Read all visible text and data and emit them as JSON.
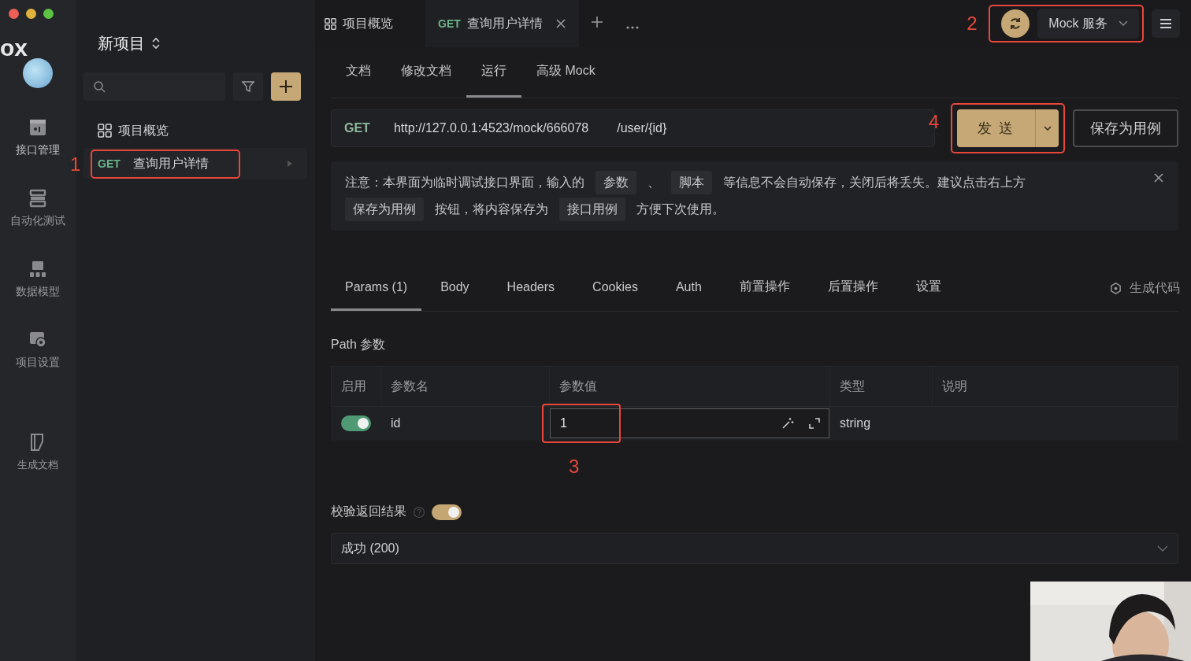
{
  "window": {
    "app_name_fragment": "ox"
  },
  "project": {
    "name": "新项目"
  },
  "rail": {
    "items": [
      {
        "kind": "api",
        "label": "接口管理",
        "selected": true
      },
      {
        "kind": "automation",
        "label": "自动化测试",
        "selected": false
      },
      {
        "kind": "schema",
        "label": "数据模型",
        "selected": false
      },
      {
        "kind": "settings",
        "label": "项目设置",
        "selected": false
      },
      {
        "kind": "docs",
        "label": "生成文档",
        "selected": false
      }
    ]
  },
  "tree": {
    "items": [
      {
        "kind": "overview",
        "label": "项目概览",
        "selected": false
      },
      {
        "kind": "endpoint",
        "method": "GET",
        "label": "查询用户详情",
        "selected": true,
        "annotation": "1"
      }
    ]
  },
  "tabs": [
    {
      "kind": "overview",
      "label": "项目概览",
      "selected": false,
      "closable": false
    },
    {
      "kind": "endpoint",
      "method": "GET",
      "label": "查询用户详情",
      "selected": true,
      "closable": true
    }
  ],
  "mock": {
    "label": "Mock 服务",
    "annotation": "2"
  },
  "subtabs": [
    {
      "label": "文档",
      "selected": false
    },
    {
      "label": "修改文档",
      "selected": false
    },
    {
      "label": "运行",
      "selected": true
    },
    {
      "label": "高级 Mock",
      "selected": false
    }
  ],
  "request": {
    "method": "GET",
    "base_url": "http://127.0.0.1:4523/mock/666078",
    "path": "/user/{id}",
    "send_label": "发 送",
    "send_annotation": "4",
    "save_label": "保存为用例"
  },
  "notice": {
    "segments": [
      {
        "kind": "text",
        "text": "注意：本界面为临时调试接口界面，输入的"
      },
      {
        "kind": "tag",
        "text": "参数"
      },
      {
        "kind": "text",
        "text": "、"
      },
      {
        "kind": "tag",
        "text": "脚本"
      },
      {
        "kind": "text",
        "text": "等信息不会自动保存，关闭后将丢失。建议点击右上方"
      },
      {
        "kind": "tag",
        "text": "保存为用例"
      },
      {
        "kind": "text",
        "text": "按钮，将内容保存为"
      },
      {
        "kind": "tag",
        "text": "接口用例"
      },
      {
        "kind": "text",
        "text": "方便下次使用。"
      }
    ]
  },
  "request_tabs": [
    {
      "label": "Params (1)",
      "selected": true
    },
    {
      "label": "Body",
      "selected": false
    },
    {
      "label": "Headers",
      "selected": false
    },
    {
      "label": "Cookies",
      "selected": false
    },
    {
      "label": "Auth",
      "selected": false
    },
    {
      "label": "前置操作",
      "selected": false
    },
    {
      "label": "后置操作",
      "selected": false
    },
    {
      "label": "设置",
      "selected": false
    }
  ],
  "generate_code": "生成代码",
  "path_params": {
    "title": "Path 参数",
    "columns": [
      "启用",
      "参数名",
      "参数值",
      "类型",
      "说明"
    ],
    "rows": [
      {
        "enabled": true,
        "name": "id",
        "value": "1",
        "type": "string",
        "annotation": "3"
      }
    ]
  },
  "validate": {
    "label": "校验返回结果",
    "on": true
  },
  "response": {
    "value": "成功 (200)"
  }
}
